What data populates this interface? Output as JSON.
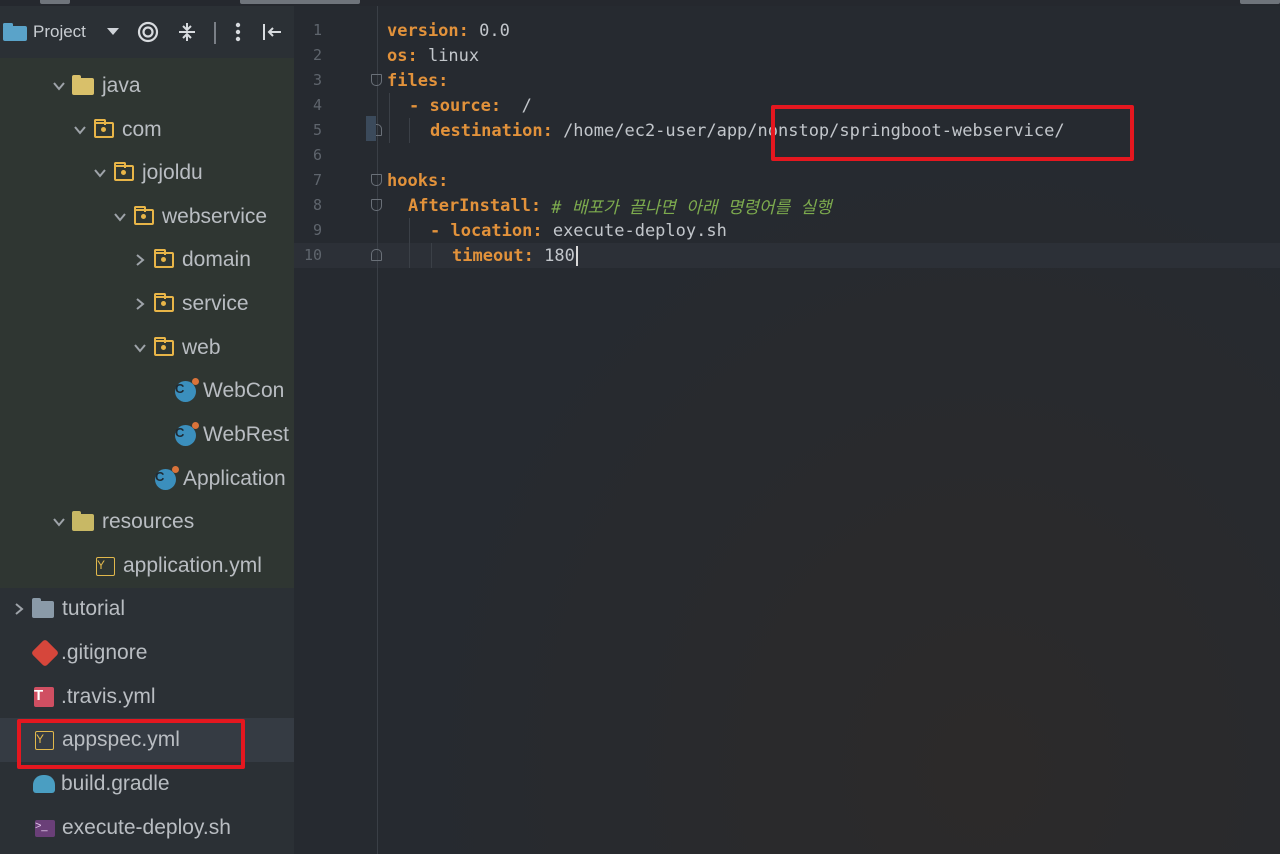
{
  "sidebar": {
    "title": "Project",
    "toolbar_icons": [
      "chevron-down-icon",
      "locate-icon",
      "collapse-all-icon",
      "more-icon",
      "hide-icon"
    ],
    "tree": [
      {
        "label": "java",
        "type": "source-folder"
      },
      {
        "label": "com",
        "type": "package"
      },
      {
        "label": "jojoldu",
        "type": "package"
      },
      {
        "label": "webservice",
        "type": "package"
      },
      {
        "label": "domain",
        "type": "package"
      },
      {
        "label": "service",
        "type": "package"
      },
      {
        "label": "web",
        "type": "package"
      },
      {
        "label": "WebCon",
        "type": "class"
      },
      {
        "label": "WebRest",
        "type": "class"
      },
      {
        "label": "Application",
        "type": "class"
      },
      {
        "label": "resources",
        "type": "resource-folder"
      },
      {
        "label": "application.yml",
        "type": "yaml"
      },
      {
        "label": "tutorial",
        "type": "folder"
      },
      {
        "label": ".gitignore",
        "type": "git"
      },
      {
        "label": ".travis.yml",
        "type": "travis"
      },
      {
        "label": "appspec.yml",
        "type": "yaml"
      },
      {
        "label": "build.gradle",
        "type": "gradle"
      },
      {
        "label": "execute-deploy.sh",
        "type": "shell"
      }
    ],
    "selected": "appspec.yml"
  },
  "editor": {
    "line_numbers": [
      "1",
      "2",
      "3",
      "4",
      "5",
      "6",
      "7",
      "8",
      "9",
      "10"
    ],
    "lines": [
      {
        "key": "version:",
        "value": " 0.0",
        "comment": ""
      },
      {
        "key": "os:",
        "value": " linux",
        "comment": ""
      },
      {
        "key": "files:",
        "value": "",
        "comment": ""
      },
      {
        "key": "- source:",
        "value": "  /",
        "comment": ""
      },
      {
        "key": "destination:",
        "value": " /home/ec2-user/app/nonstop/springboot-webservice/",
        "comment": ""
      },
      {
        "key": "",
        "value": "",
        "comment": ""
      },
      {
        "key": "hooks:",
        "value": "",
        "comment": ""
      },
      {
        "key": "AfterInstall:",
        "value": "",
        "comment": " # 배포가 끝나면 아래 명령어를 실행"
      },
      {
        "key": "- location:",
        "value": " execute-deploy.sh",
        "comment": ""
      },
      {
        "key": "timeout:",
        "value": " 180",
        "comment": ""
      }
    ]
  },
  "colors": {
    "key": "#e2923b",
    "value": "#c2c6cb",
    "comment": "#7dab4e",
    "highlight_box": "#e5171f",
    "package_icon": "#e8b548",
    "class_icon": "#3b8fbd"
  }
}
